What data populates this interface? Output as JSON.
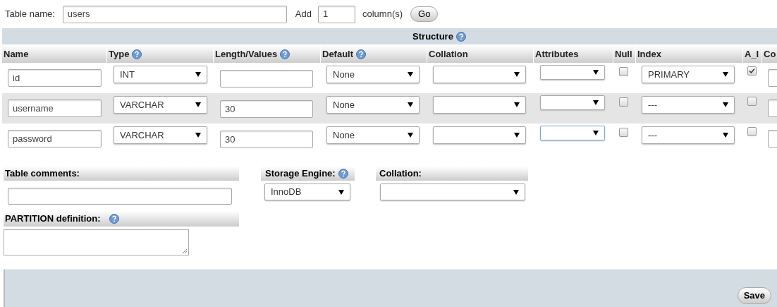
{
  "table_name": {
    "label": "Table name:",
    "value": "users"
  },
  "add": {
    "label": "Add",
    "value": "1",
    "suffix": "column(s)",
    "button": "Go"
  },
  "structure": {
    "title": "Structure",
    "help": true,
    "columns": [
      {
        "label": "Name"
      },
      {
        "label": "Type",
        "help": true
      },
      {
        "label": "Length/Values",
        "help": true
      },
      {
        "label": "Default",
        "help": true
      },
      {
        "label": "Collation"
      },
      {
        "label": "Attributes"
      },
      {
        "label": "Null"
      },
      {
        "label": "Index"
      },
      {
        "label": "A_I"
      },
      {
        "label": "Co"
      }
    ],
    "rows": [
      {
        "name": "id",
        "type": "INT",
        "default": "None",
        "null": false,
        "index": "PRIMARY",
        "a_i": true,
        "attributes_focused": false
      },
      {
        "name": "username",
        "type": "VARCHAR",
        "length": "30",
        "default": "None",
        "null": false,
        "index": "---",
        "a_i": false,
        "attributes_focused": false
      },
      {
        "name": "password",
        "type": "VARCHAR",
        "length": "30",
        "default": "None",
        "null": false,
        "index": "---",
        "a_i": false,
        "attributes_focused": true
      }
    ]
  },
  "options": {
    "table_comments": {
      "label": "Table comments:"
    },
    "storage_engine": {
      "label": "Storage Engine:",
      "help": true,
      "value": "InnoDB"
    },
    "collation": {
      "label": "Collation:"
    },
    "partition": {
      "label": "PARTITION definition:",
      "help": true
    }
  },
  "footer": {
    "button": "Save"
  }
}
